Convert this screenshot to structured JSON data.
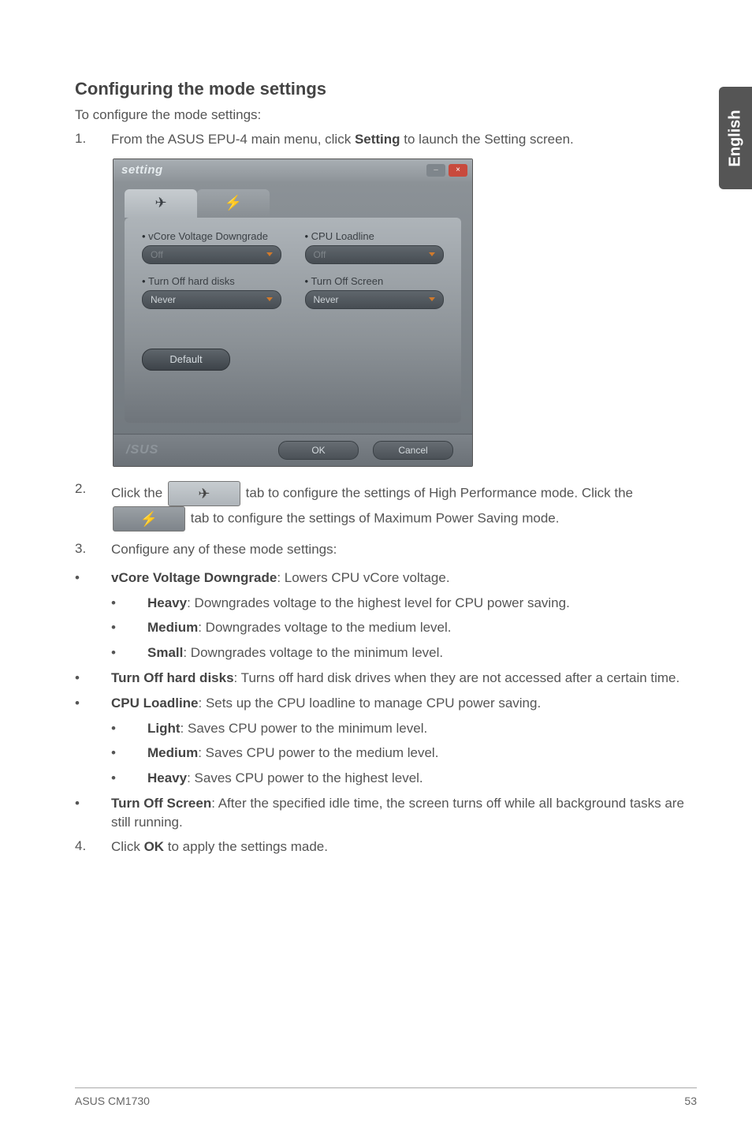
{
  "sideTab": "English",
  "heading": "Configuring the mode settings",
  "intro": "To configure the mode settings:",
  "steps": {
    "s1": {
      "num": "1.",
      "text_a": "From the ASUS EPU-4 main menu, click ",
      "text_bold": "Setting",
      "text_b": "  to launch the Setting screen."
    },
    "s2": {
      "num": "2.",
      "text_a": "Click the ",
      "text_b": " tab to configure the settings of High Performance mode. Click the ",
      "text_c": " tab to configure the settings of Maximum Power Saving mode."
    },
    "s3": {
      "num": "3.",
      "text": "Configure any of these mode settings:"
    },
    "s4": {
      "num": "4.",
      "text_a": "Click ",
      "text_bold": "OK",
      "text_b": " to apply the settings made."
    }
  },
  "bullets": {
    "b1": {
      "bold": "vCore Voltage Downgrade",
      "rest": ": Lowers CPU vCore voltage."
    },
    "b1a": {
      "bold": "Heavy",
      "rest": ": Downgrades voltage to the highest level for CPU power saving."
    },
    "b1b": {
      "bold": "Medium",
      "rest": ": Downgrades voltage to the medium level."
    },
    "b1c": {
      "bold": "Small",
      "rest": ": Downgrades voltage to the minimum level."
    },
    "b2": {
      "bold": "Turn Off hard disks",
      "rest": ": Turns off hard disk drives when they are not accessed after a certain time."
    },
    "b3": {
      "bold": "CPU Loadline",
      "rest": ": Sets up the CPU loadline to manage CPU power saving."
    },
    "b3a": {
      "bold": "Light",
      "rest": ": Saves CPU power to the minimum level."
    },
    "b3b": {
      "bold": "Medium",
      "rest": ": Saves CPU power to the medium level."
    },
    "b3c": {
      "bold": "Heavy",
      "rest": ": Saves CPU power to the highest level."
    },
    "b4": {
      "bold": "Turn Off Screen",
      "rest": ": After the specified idle time, the screen turns off while all background tasks are still running."
    }
  },
  "screenshot": {
    "title": "setting",
    "minimize": "–",
    "close": "×",
    "tab1_glyph": "✈",
    "tab2_glyph": "⚡",
    "labels": {
      "vcore": "vCore Voltage Downgrade",
      "cpu": "CPU Loadline",
      "hdd": "Turn Off hard disks",
      "screen": "Turn Off Screen"
    },
    "values": {
      "vcore": "Off",
      "cpu": "Off",
      "hdd": "Never",
      "screen": "Never"
    },
    "default_btn": "Default",
    "logo": "/SUS",
    "ok": "OK",
    "cancel": "Cancel"
  },
  "inline_tab_glyph_hp": "✈",
  "inline_tab_glyph_ps": "⚡",
  "footer": {
    "left": "ASUS CM1730",
    "right": "53"
  }
}
